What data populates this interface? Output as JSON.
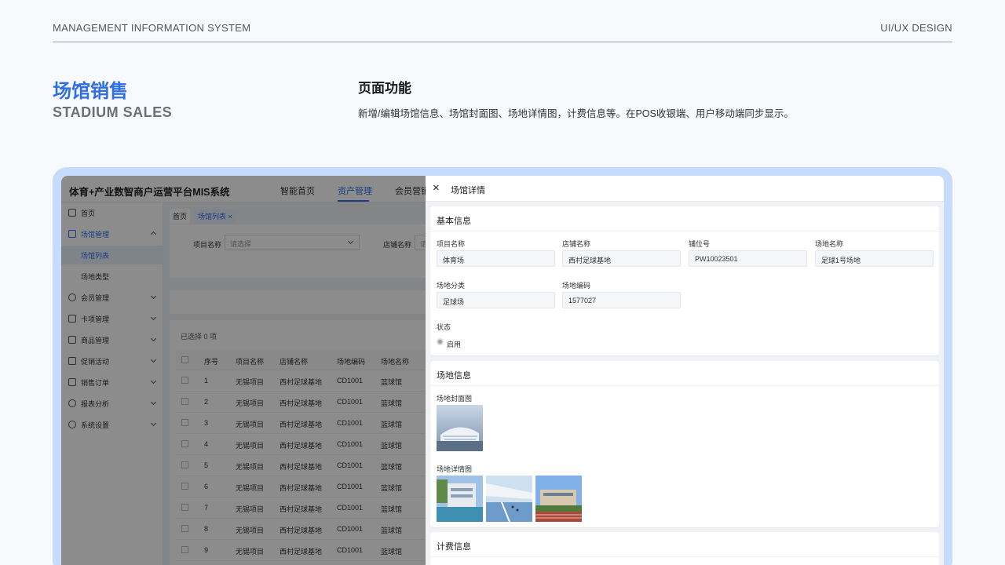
{
  "page_header": {
    "left": "MANAGEMENT INFORMATION SYSTEM",
    "right": "UI/UX DESIGN"
  },
  "section": {
    "title_zh": "场馆销售",
    "title_en": "STADIUM SALES"
  },
  "feature": {
    "title": "页面功能",
    "desc": "新增/编辑场馆信息、场馆封面图、场地详情图，计费信息等。在POS收银端、用户移动端同步显示。"
  },
  "app": {
    "brand": "体育+产业数智商户运营平台MIS系统",
    "nav": [
      "智能首页",
      "资产管理",
      "会员营销"
    ],
    "nav_active": "资产管理",
    "sidebar": [
      {
        "label": "首页",
        "icon": "home-icon"
      },
      {
        "label": "场馆管理",
        "icon": "venue-icon"
      },
      {
        "label": "场馆列表"
      },
      {
        "label": "场地类型"
      },
      {
        "label": "会员管理",
        "icon": "user-icon"
      },
      {
        "label": "卡项管理",
        "icon": "card-icon"
      },
      {
        "label": "商品管理",
        "icon": "goods-icon"
      },
      {
        "label": "促销活动",
        "icon": "promo-icon"
      },
      {
        "label": "销售订单",
        "icon": "order-icon"
      },
      {
        "label": "报表分析",
        "icon": "report-icon"
      },
      {
        "label": "系统设置",
        "icon": "settings-icon"
      }
    ],
    "breadcrumb": {
      "home": "首页",
      "current": "场馆列表",
      "close": "×"
    },
    "filters": {
      "project_label": "项目名称",
      "project_placeholder": "请选择",
      "store_label": "店铺名称",
      "store_placeholder": "请"
    },
    "selected_text": "已选择 0 项",
    "table": {
      "headers": [
        "序号",
        "项目名称",
        "店铺名称",
        "场地编码",
        "场地名称"
      ],
      "rows": [
        [
          "1",
          "无锡项目",
          "西村足球基地",
          "CD1001",
          "篮球馆"
        ],
        [
          "2",
          "无锡项目",
          "西村足球基地",
          "CD1001",
          "篮球馆"
        ],
        [
          "3",
          "无锡项目",
          "西村足球基地",
          "CD1001",
          "篮球馆"
        ],
        [
          "4",
          "无锡项目",
          "西村足球基地",
          "CD1001",
          "篮球馆"
        ],
        [
          "5",
          "无锡项目",
          "西村足球基地",
          "CD1001",
          "篮球馆"
        ],
        [
          "6",
          "无锡项目",
          "西村足球基地",
          "CD1001",
          "篮球馆"
        ],
        [
          "7",
          "无锡项目",
          "西村足球基地",
          "CD1001",
          "篮球馆"
        ],
        [
          "8",
          "无锡项目",
          "西村足球基地",
          "CD1001",
          "篮球馆"
        ],
        [
          "9",
          "无锡项目",
          "西村足球基地",
          "CD1001",
          "篮球馆"
        ]
      ]
    }
  },
  "drawer": {
    "close": "×",
    "title": "场馆详情",
    "basic": {
      "title": "基本信息",
      "fields": [
        {
          "label": "项目名称",
          "value": "体育场"
        },
        {
          "label": "店铺名称",
          "value": "西村足球基地"
        },
        {
          "label": "铺位号",
          "value": "PW10023501"
        },
        {
          "label": "场地名称",
          "value": "足球1号场地"
        },
        {
          "label": "场地分类",
          "value": "足球场"
        },
        {
          "label": "场地编码",
          "value": "1577027"
        }
      ],
      "status_label": "状态",
      "status_value": "启用"
    },
    "venue": {
      "title": "场地信息",
      "cover_label": "场地封面图",
      "detail_label": "场地详情图"
    },
    "billing": {
      "title": "计费信息"
    }
  }
}
